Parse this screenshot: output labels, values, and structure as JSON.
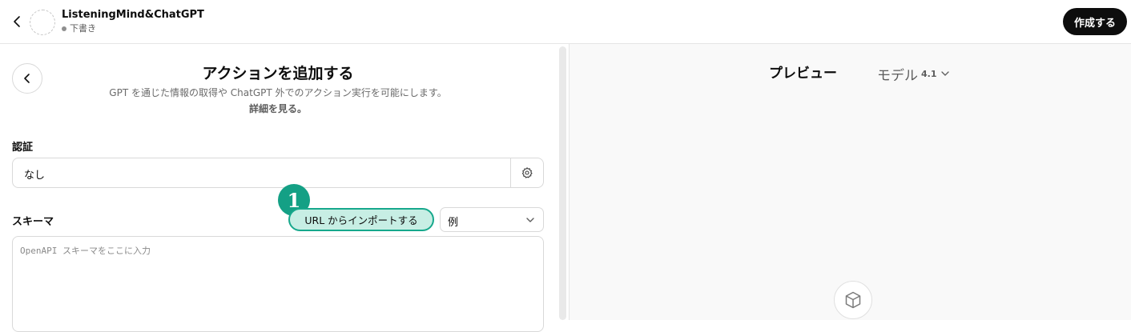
{
  "header": {
    "gpt_name": "ListeningMind&ChatGPT",
    "status": "下書き",
    "create_label": "作成する"
  },
  "action_panel": {
    "title": "アクションを追加する",
    "description": "GPT を通じた情報の取得や ChatGPT 外でのアクション実行を可能にします。",
    "learn_more": "詳細を見る。",
    "auth": {
      "label": "認証",
      "value": "なし"
    },
    "schema": {
      "label": "スキーマ",
      "import_label": "URL からインポートする",
      "examples_label": "例",
      "placeholder": "OpenAPI スキーマをここに入力"
    },
    "step_badge": "1"
  },
  "preview": {
    "title": "プレビュー",
    "model_label": "モデル",
    "model_version": "4.1"
  },
  "colors": {
    "accent_teal": "#17a88c",
    "badge_teal": "#14a085",
    "highlight_fill": "#c7eee4",
    "primary_button": "#0d0d0d"
  }
}
